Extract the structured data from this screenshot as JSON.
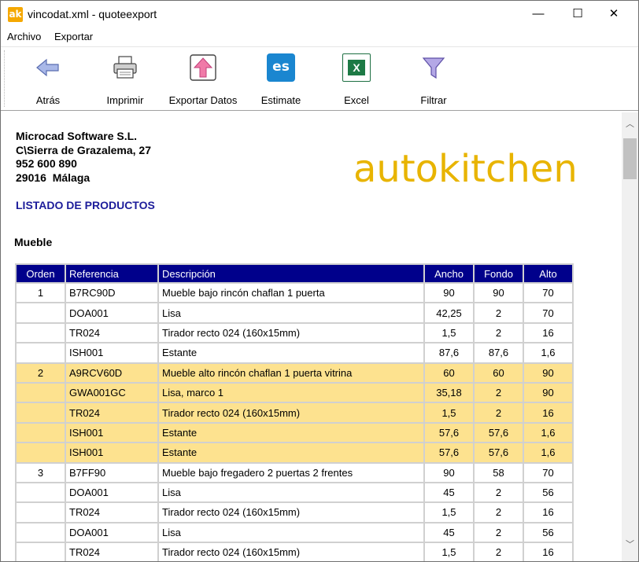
{
  "window": {
    "app_icon": "ak",
    "title": "vincodat.xml - quoteexport",
    "controls": {
      "minimize": "—",
      "maximize": "☐",
      "close": "✕"
    }
  },
  "menu": [
    "Archivo",
    "Exportar"
  ],
  "toolbar": [
    {
      "label": "Atrás",
      "icon": "back-arrow-icon"
    },
    {
      "label": "Imprimir",
      "icon": "printer-icon"
    },
    {
      "label": "Exportar Datos",
      "icon": "export-up-arrow-icon"
    },
    {
      "label": "Estimate",
      "icon": "estimate-es-icon",
      "icon_text": "es"
    },
    {
      "label": "Excel",
      "icon": "excel-icon",
      "icon_text": "X"
    },
    {
      "label": "Filtrar",
      "icon": "filter-funnel-icon"
    }
  ],
  "company": {
    "name": "Microcad Software S.L.",
    "address": "C\\Sierra de Grazalema, 27",
    "phone": "952 600 890",
    "city": "29016  Málaga"
  },
  "logo_text": "autokitchen",
  "report_title": "LISTADO DE PRODUCTOS",
  "section_title": "Mueble",
  "table": {
    "headers": [
      "Orden",
      "Referencia",
      "Descripción",
      "Ancho",
      "Fondo",
      "Alto"
    ],
    "rows": [
      {
        "orden": "1",
        "ref": "B7RC90D",
        "desc": "Mueble bajo rincón chaflan 1 puerta",
        "ancho": "90",
        "fondo": "90",
        "alto": "70",
        "highlight": false
      },
      {
        "orden": "",
        "ref": "DOA001",
        "desc": "Lisa",
        "ancho": "42,25",
        "fondo": "2",
        "alto": "70",
        "highlight": false
      },
      {
        "orden": "",
        "ref": "TR024",
        "desc": "Tirador recto 024 (160x15mm)",
        "ancho": "1,5",
        "fondo": "2",
        "alto": "16",
        "highlight": false
      },
      {
        "orden": "",
        "ref": "ISH001",
        "desc": "Estante",
        "ancho": "87,6",
        "fondo": "87,6",
        "alto": "1,6",
        "highlight": false
      },
      {
        "orden": "2",
        "ref": "A9RCV60D",
        "desc": "Mueble alto rincón chaflan 1 puerta vitrina",
        "ancho": "60",
        "fondo": "60",
        "alto": "90",
        "highlight": true
      },
      {
        "orden": "",
        "ref": "GWA001GC",
        "desc": "Lisa, marco 1",
        "ancho": "35,18",
        "fondo": "2",
        "alto": "90",
        "highlight": true
      },
      {
        "orden": "",
        "ref": "TR024",
        "desc": "Tirador recto 024 (160x15mm)",
        "ancho": "1,5",
        "fondo": "2",
        "alto": "16",
        "highlight": true
      },
      {
        "orden": "",
        "ref": "ISH001",
        "desc": "Estante",
        "ancho": "57,6",
        "fondo": "57,6",
        "alto": "1,6",
        "highlight": true
      },
      {
        "orden": "",
        "ref": "ISH001",
        "desc": "Estante",
        "ancho": "57,6",
        "fondo": "57,6",
        "alto": "1,6",
        "highlight": true
      },
      {
        "orden": "3",
        "ref": "B7FF90",
        "desc": "Mueble bajo fregadero 2 puertas 2 frentes",
        "ancho": "90",
        "fondo": "58",
        "alto": "70",
        "highlight": false
      },
      {
        "orden": "",
        "ref": "DOA001",
        "desc": "Lisa",
        "ancho": "45",
        "fondo": "2",
        "alto": "56",
        "highlight": false
      },
      {
        "orden": "",
        "ref": "TR024",
        "desc": "Tirador recto 024 (160x15mm)",
        "ancho": "1,5",
        "fondo": "2",
        "alto": "16",
        "highlight": false
      },
      {
        "orden": "",
        "ref": "DOA001",
        "desc": "Lisa",
        "ancho": "45",
        "fondo": "2",
        "alto": "56",
        "highlight": false
      },
      {
        "orden": "",
        "ref": "TR024",
        "desc": "Tirador recto 024 (160x15mm)",
        "ancho": "1,5",
        "fondo": "2",
        "alto": "16",
        "highlight": false
      }
    ]
  },
  "colors": {
    "header_bg": "#00008b",
    "highlight_row": "#fde28f",
    "logo": "#e8b400",
    "report_title": "#1c1c9a",
    "app_icon": "#f5a800"
  }
}
